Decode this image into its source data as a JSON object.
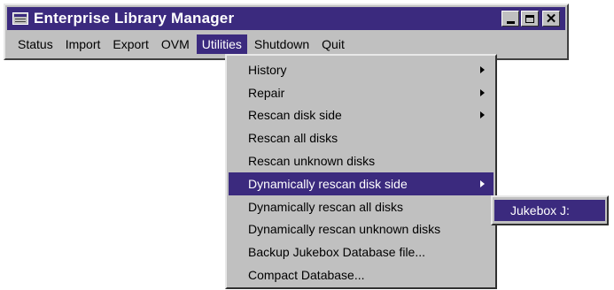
{
  "window": {
    "title": "Enterprise Library Manager",
    "controls": {
      "minimize_icon": "minimize-icon",
      "maximize_icon": "maximize-icon",
      "close_glyph": "✕"
    }
  },
  "menubar": {
    "items": [
      {
        "label": "Status"
      },
      {
        "label": "Import"
      },
      {
        "label": "Export"
      },
      {
        "label": "OVM"
      },
      {
        "label": "Utilities",
        "active": true
      },
      {
        "label": "Shutdown"
      },
      {
        "label": "Quit"
      }
    ]
  },
  "utilities_menu": {
    "items": [
      {
        "label": "History",
        "submenu": true
      },
      {
        "label": "Repair",
        "submenu": true
      },
      {
        "label": "Rescan disk side",
        "submenu": true
      },
      {
        "label": "Rescan all disks"
      },
      {
        "label": "Rescan unknown disks"
      },
      {
        "label": "Dynamically rescan disk side",
        "submenu": true,
        "highlighted": true
      },
      {
        "label": "Dynamically rescan all disks"
      },
      {
        "label": "Dynamically rescan unknown disks"
      },
      {
        "label": "Backup Jukebox Database file..."
      },
      {
        "label": "Compact Database..."
      }
    ]
  },
  "submenu": {
    "items": [
      {
        "label": "Jukebox J:",
        "highlighted": true
      }
    ]
  },
  "colors": {
    "titlebar": "#3b2a7e",
    "highlight": "#3b2a7e",
    "face": "#c0c0c0"
  }
}
